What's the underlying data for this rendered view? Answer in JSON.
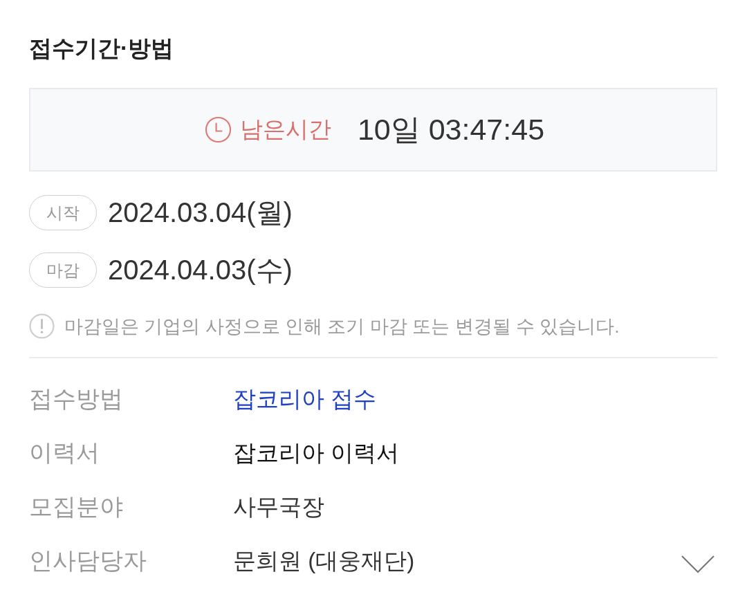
{
  "section_title": "접수기간·방법",
  "countdown": {
    "label": "남은시간",
    "value": "10일 03:47:45"
  },
  "dates": [
    {
      "tag": "시작",
      "date": "2024.03.04(월)"
    },
    {
      "tag": "마감",
      "date": "2024.04.03(수)"
    }
  ],
  "notice": "마감일은 기업의 사정으로 인해 조기 마감 또는 변경될 수 있습니다.",
  "details": [
    {
      "label": "접수방법",
      "value": "잡코리아 접수",
      "kind": "link"
    },
    {
      "label": "이력서",
      "value": "잡코리아 이력서",
      "kind": "strong"
    },
    {
      "label": "모집분야",
      "value": "사무국장",
      "kind": "text"
    },
    {
      "label": "인사담당자",
      "value": "문희원 (대웅재단)",
      "kind": "text"
    }
  ],
  "details_toggle": {
    "expanded": false
  }
}
